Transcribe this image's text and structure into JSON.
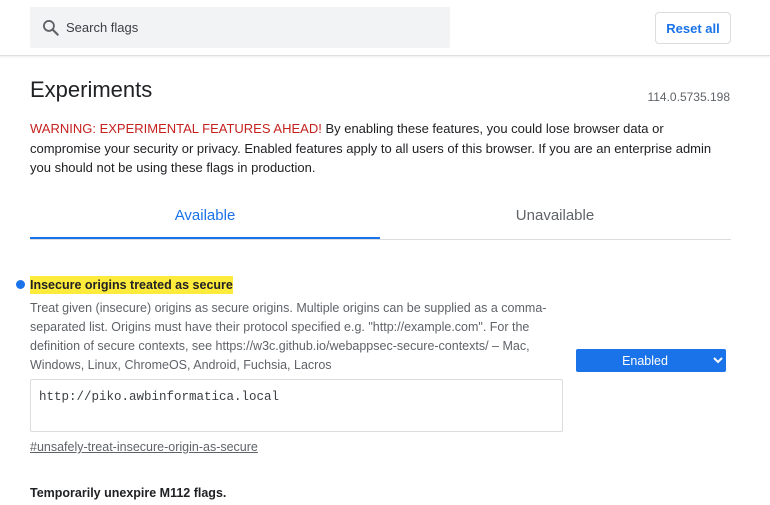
{
  "header": {
    "search_placeholder": "Search flags",
    "reset_label": "Reset all"
  },
  "page": {
    "title": "Experiments",
    "version": "114.0.5735.198",
    "warning_strong": "WARNING: EXPERIMENTAL FEATURES AHEAD!",
    "warning_text": " By enabling these features, you could lose browser data or compromise your security or privacy. Enabled features apply to all users of this browser. If you are an enterprise admin you should not be using these flags in production."
  },
  "tabs": [
    {
      "label": "Available"
    },
    {
      "label": "Unavailable"
    }
  ],
  "flag": {
    "title": "Insecure origins treated as secure",
    "description": "Treat given (insecure) origins as secure origins. Multiple origins can be supplied as a comma-separated list. Origins must have their protocol specified e.g. \"http://example.com\". For the definition of secure contexts, see https://w3c.github.io/webappsec-secure-contexts/ – Mac, Windows, Linux, ChromeOS, Android, Fuchsia, Lacros",
    "value": "http://piko.awbinformatica.local",
    "link": "#unsafely-treat-insecure-origin-as-secure",
    "state": "Enabled"
  },
  "next_flag": {
    "title": "Temporarily unexpire M112 flags."
  },
  "colors": {
    "accent": "#1a73e8",
    "warning": "#c5221f",
    "highlight": "#ffeb3b"
  }
}
